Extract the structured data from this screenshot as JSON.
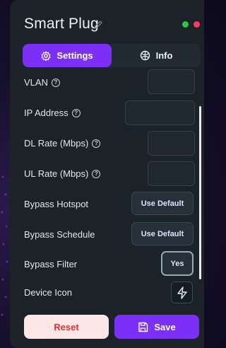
{
  "header": {
    "title": "Smart Plug",
    "title_icon": "pencil-icon",
    "status_icons": [
      "check-circle-icon",
      "close-circle-icon"
    ]
  },
  "tabs": [
    {
      "label": "Settings",
      "icon": "gear-icon",
      "active": true
    },
    {
      "label": "Info",
      "icon": "info-icon",
      "active": false
    }
  ],
  "settings": {
    "vlan_label": "VLAN",
    "ip_address_label": "IP Address",
    "dl_rate_label": "DL Rate (Mbps)",
    "ul_rate_label": "UL Rate (Mbps)",
    "bypass_hotspot_label": "Bypass Hotspot",
    "bypass_hotspot_value": "Use Default",
    "bypass_schedule_label": "Bypass Schedule",
    "bypass_schedule_value": "Use Default",
    "bypass_filter_label": "Bypass Filter",
    "bypass_filter_value": "Yes",
    "device_icon_label": "Device Icon",
    "device_icon": "lightning-icon"
  },
  "footer": {
    "reset_label": "Reset",
    "save_label": "Save",
    "save_icon": "save-icon"
  },
  "colors": {
    "accent": "#7b2ff7",
    "reset_text": "#e5303a",
    "reset_bg": "#fde6e6",
    "status_ok": "#27c93f",
    "status_close": "#ff3b5c"
  }
}
